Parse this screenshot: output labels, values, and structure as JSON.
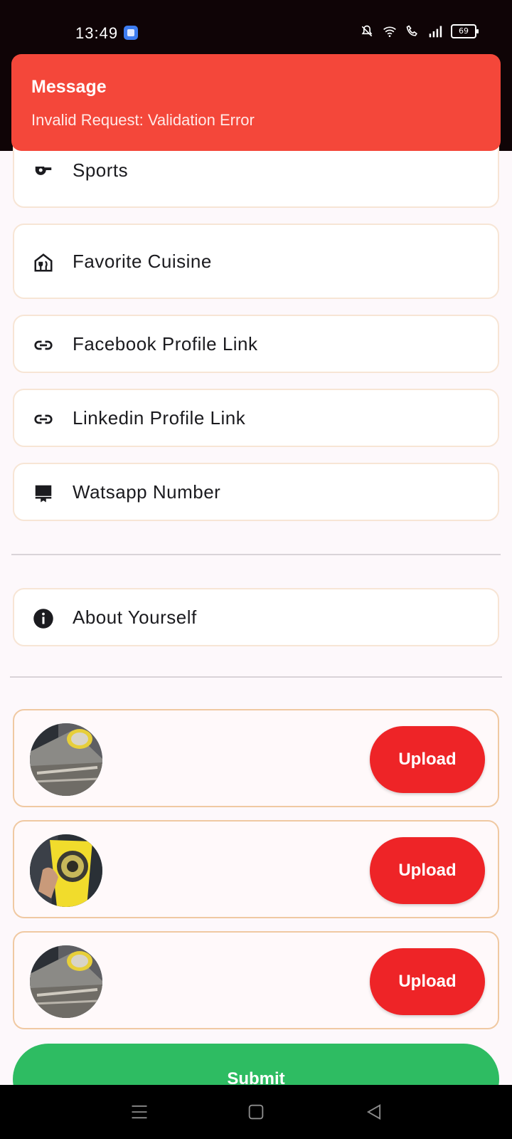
{
  "status_bar": {
    "time": "13:49",
    "battery": "69"
  },
  "toast": {
    "title": "Message",
    "message": "Invalid Request: Validation Error"
  },
  "fields": [
    {
      "label": "Sports",
      "icon": "whistle-icon"
    },
    {
      "label": "Favorite Cuisine",
      "icon": "restaurant-icon"
    },
    {
      "label": "Facebook Profile Link",
      "icon": "link-icon"
    },
    {
      "label": "Linkedin Profile Link",
      "icon": "link-icon"
    },
    {
      "label": "Watsapp Number",
      "icon": "phone-icon"
    }
  ],
  "about": {
    "label": "About Yourself",
    "icon": "info-icon"
  },
  "uploads": [
    {
      "button": "Upload"
    },
    {
      "button": "Upload"
    },
    {
      "button": "Upload"
    }
  ],
  "submit_label": "Submit",
  "colors": {
    "toast": "#f4473a",
    "upload_button": "#ee2427",
    "submit": "#2ebc62",
    "card_border": "#f7e5d5"
  }
}
